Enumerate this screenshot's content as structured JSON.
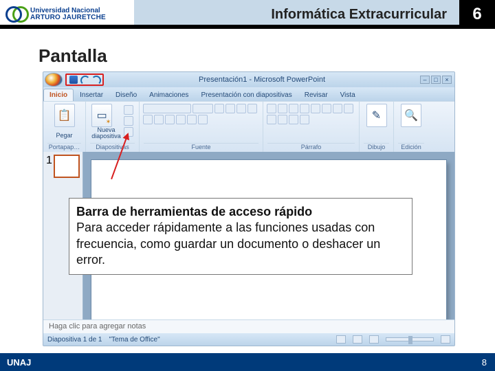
{
  "header": {
    "university_line1": "Universidad Nacional",
    "university_line2": "ARTURO JAURETCHE",
    "course_title": "Informática Extracurricular",
    "page_number_top": "6"
  },
  "section_title": "Pantalla",
  "ppwin": {
    "doc_title": "Presentación1 - Microsoft PowerPoint",
    "tabs": {
      "inicio": "Inicio",
      "insertar": "Insertar",
      "diseno": "Diseño",
      "animaciones": "Animaciones",
      "presentacion": "Presentación con diapositivas",
      "revisar": "Revisar",
      "vista": "Vista"
    },
    "groups": {
      "portapapeles": "Portapap…",
      "pegar": "Pegar",
      "diapositivas": "Diapositivas",
      "nueva": "Nueva",
      "diapositiva": "diapositiva",
      "fuente": "Fuente",
      "parrafo": "Párrafo",
      "dibujo": "Dibujo",
      "edicion": "Edición"
    },
    "thumb_number": "1",
    "notes_placeholder": "Haga clic para agregar notas",
    "status_slide": "Diapositiva 1 de 1",
    "status_theme": "\"Tema de Office\""
  },
  "callout": {
    "title": "Barra de herramientas de acceso rápido",
    "body": "Para acceder rápidamente a las funciones usadas con frecuencia, como guardar un documento o deshacer un error."
  },
  "footer": {
    "uni_abbr": "UNAJ",
    "page_number_bottom": "8"
  }
}
